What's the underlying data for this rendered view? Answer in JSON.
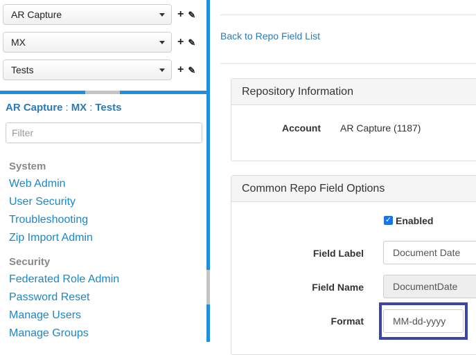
{
  "selectors": [
    {
      "label": "AR Capture"
    },
    {
      "label": "MX"
    },
    {
      "label": "Tests"
    }
  ],
  "selector_icons": {
    "add": "+",
    "edit": "✎"
  },
  "breadcrumb": {
    "part1": "AR Capture",
    "sep1": ":",
    "part2": "MX",
    "sep2": ":",
    "part3": "Tests"
  },
  "filter": {
    "placeholder": "Filter",
    "value": ""
  },
  "nav": {
    "system_header": "System",
    "system_items": [
      "Web Admin",
      "User Security",
      "Troubleshooting",
      "Zip Import Admin"
    ],
    "security_header": "Security",
    "security_items": [
      "Federated Role Admin",
      "Password Reset",
      "Manage Users",
      "Manage Groups"
    ]
  },
  "main": {
    "back_link": "Back to Repo Field List",
    "repo_info": {
      "heading": "Repository Information",
      "account_label": "Account",
      "account_value": "AR Capture (1187)"
    },
    "options": {
      "heading": "Common Repo Field Options",
      "enabled_label": "Enabled",
      "enabled_checked": true,
      "field_label_label": "Field Label",
      "field_label_value": "Document Date",
      "field_name_label": "Field Name",
      "field_name_value": "DocumentDate",
      "format_label": "Format",
      "format_value": "MM-dd-yyyy"
    }
  },
  "colors": {
    "accent": "#1f8fde",
    "link": "#1a87c9",
    "highlight": "#3b44a8"
  }
}
